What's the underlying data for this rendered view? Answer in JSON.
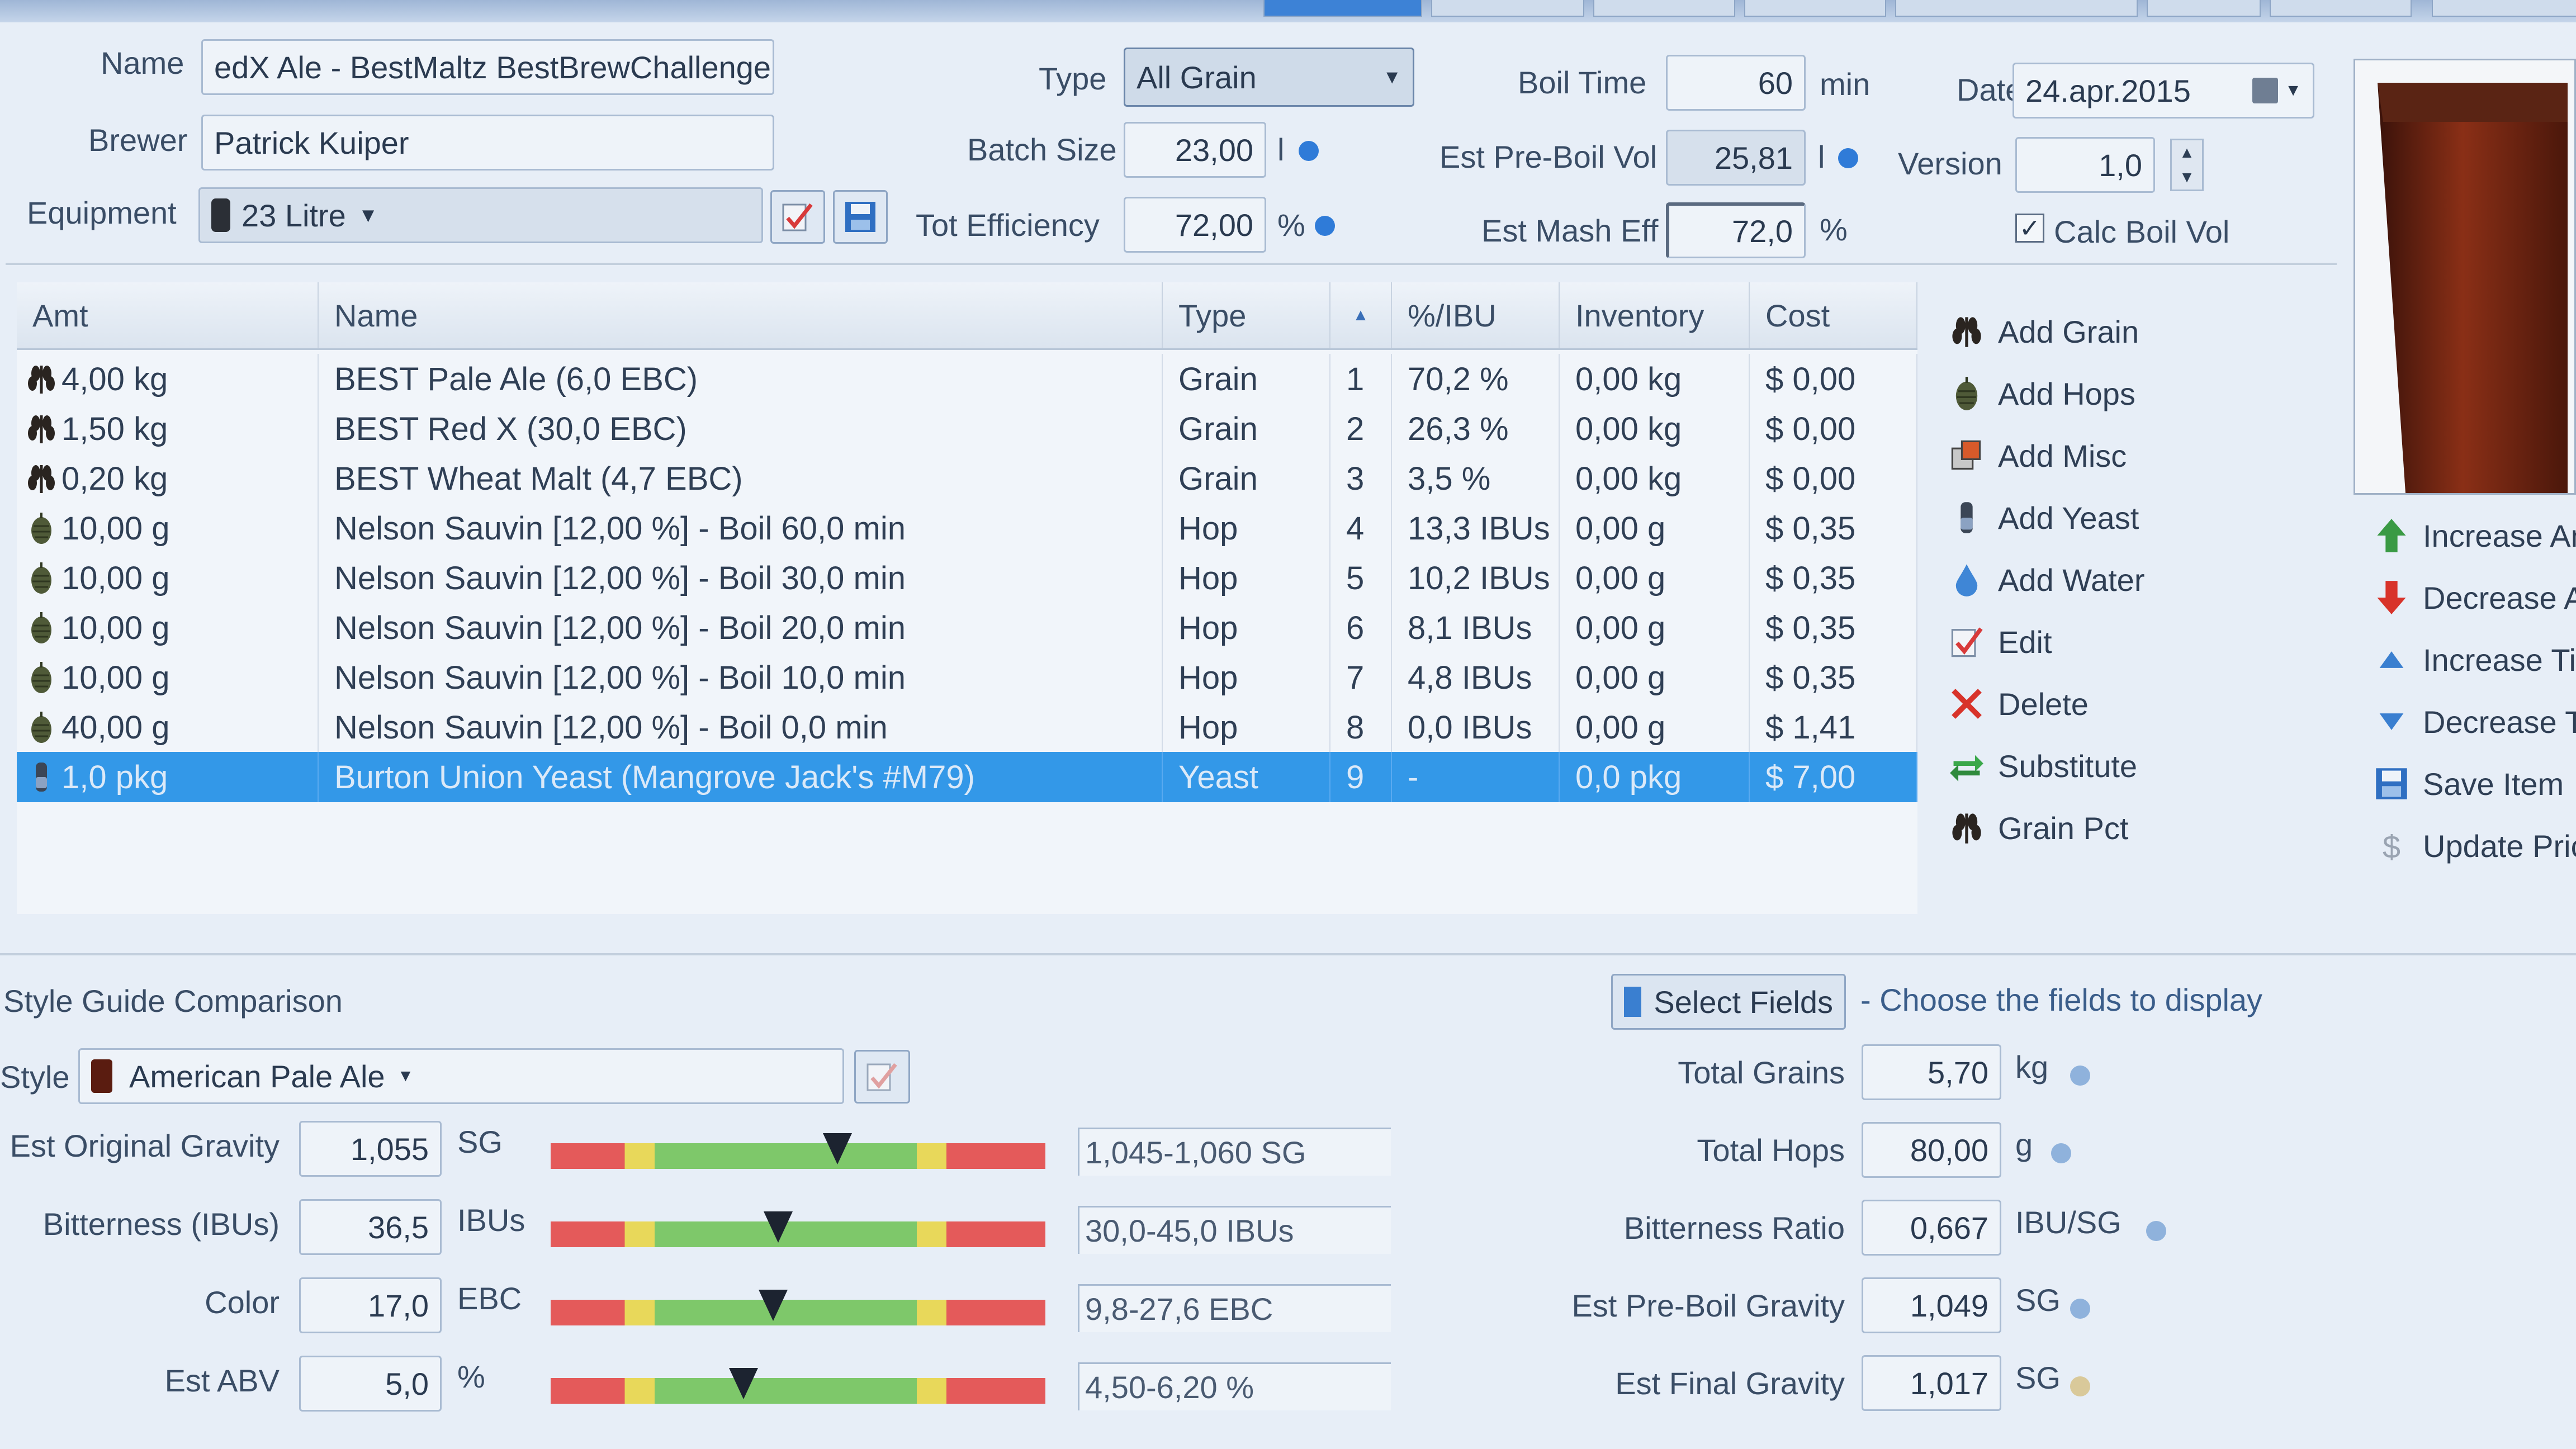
{
  "header": {
    "name_label": "Name",
    "name_value": "edX Ale - BestMaltz BestBrewChallenge",
    "brewer_label": "Brewer",
    "brewer_value": "Patrick Kuiper",
    "equipment_label": "Equipment",
    "equipment_value": "23 Litre",
    "type_label": "Type",
    "type_value": "All Grain",
    "batch_label": "Batch Size",
    "batch_value": "23,00",
    "batch_unit": "l",
    "eff_label": "Tot Efficiency",
    "eff_value": "72,00",
    "eff_unit": "%",
    "boil_label": "Boil Time",
    "boil_value": "60",
    "boil_unit": "min",
    "preboil_label": "Est Pre-Boil Vol",
    "preboil_value": "25,81",
    "preboil_unit": "l",
    "mash_label": "Est Mash Eff",
    "mash_value": "72,0",
    "mash_unit": "%",
    "date_label": "Date",
    "date_value": "24.apr.2015",
    "version_label": "Version",
    "version_value": "1,0",
    "calc_label": "Calc Boil Vol"
  },
  "grid": {
    "columns": [
      "Amt",
      "Name",
      "Type",
      "%/IBU",
      "Inventory",
      "Cost"
    ],
    "rows": [
      {
        "amt": "4,00 kg",
        "name": "BEST Pale Ale (6,0 EBC)",
        "type": "Grain",
        "num": "1",
        "ibu": "70,2 %",
        "inv": "0,00 kg",
        "cost": "$ 0,00",
        "icon": "grain-icon"
      },
      {
        "amt": "1,50 kg",
        "name": "BEST Red X (30,0 EBC)",
        "type": "Grain",
        "num": "2",
        "ibu": "26,3 %",
        "inv": "0,00 kg",
        "cost": "$ 0,00",
        "icon": "grain-icon"
      },
      {
        "amt": "0,20 kg",
        "name": "BEST Wheat Malt (4,7 EBC)",
        "type": "Grain",
        "num": "3",
        "ibu": "3,5 %",
        "inv": "0,00 kg",
        "cost": "$ 0,00",
        "icon": "grain-icon"
      },
      {
        "amt": "10,00 g",
        "name": "Nelson Sauvin [12,00 %] - Boil 60,0 min",
        "type": "Hop",
        "num": "4",
        "ibu": "13,3 IBUs",
        "inv": "0,00 g",
        "cost": "$ 0,35",
        "icon": "hop-icon"
      },
      {
        "amt": "10,00 g",
        "name": "Nelson Sauvin [12,00 %] - Boil 30,0 min",
        "type": "Hop",
        "num": "5",
        "ibu": "10,2 IBUs",
        "inv": "0,00 g",
        "cost": "$ 0,35",
        "icon": "hop-icon"
      },
      {
        "amt": "10,00 g",
        "name": "Nelson Sauvin [12,00 %] - Boil 20,0 min",
        "type": "Hop",
        "num": "6",
        "ibu": "8,1 IBUs",
        "inv": "0,00 g",
        "cost": "$ 0,35",
        "icon": "hop-icon"
      },
      {
        "amt": "10,00 g",
        "name": "Nelson Sauvin [12,00 %] - Boil 10,0 min",
        "type": "Hop",
        "num": "7",
        "ibu": "4,8 IBUs",
        "inv": "0,00 g",
        "cost": "$ 0,35",
        "icon": "hop-icon"
      },
      {
        "amt": "40,00 g",
        "name": "Nelson Sauvin [12,00 %] - Boil 0,0 min",
        "type": "Hop",
        "num": "8",
        "ibu": "0,0 IBUs",
        "inv": "0,00 g",
        "cost": "$ 1,41",
        "icon": "hop-icon"
      },
      {
        "amt": "1,0 pkg",
        "name": "Burton Union Yeast (Mangrove Jack's #M79)",
        "type": "Yeast",
        "num": "9",
        "ibu": "-",
        "inv": "0,0 pkg",
        "cost": "$ 7,00",
        "icon": "yeast-icon",
        "selected": true
      }
    ]
  },
  "actions": [
    {
      "label": "Add Grain",
      "icon": "grain-icon"
    },
    {
      "label": "Add Hops",
      "icon": "hop-icon"
    },
    {
      "label": "Add Misc",
      "icon": "misc-icon"
    },
    {
      "label": "Add Yeast",
      "icon": "yeast-icon"
    },
    {
      "label": "Add Water",
      "icon": "water-drop-icon"
    },
    {
      "label": "Edit",
      "icon": "edit-check-icon"
    },
    {
      "label": "Delete",
      "icon": "delete-x-icon"
    },
    {
      "label": "Substitute",
      "icon": "substitute-arrows-icon"
    },
    {
      "label": "Grain Pct",
      "icon": "grain-icon"
    }
  ],
  "side_actions": [
    {
      "label": "Increase Am",
      "icon": "up-arrow-icon"
    },
    {
      "label": "Decrease Ar",
      "icon": "down-arrow-icon"
    },
    {
      "label": "Increase Tin",
      "icon": "up-triangle-icon"
    },
    {
      "label": "Decrease Ti",
      "icon": "down-triangle-icon"
    },
    {
      "label": "Save Item",
      "icon": "save-icon"
    },
    {
      "label": "Update Pric",
      "icon": "dollar-icon"
    }
  ],
  "style": {
    "section_title": "Style Guide Comparison",
    "style_label": "Style",
    "style_value": "American Pale Ale",
    "select_fields": "Select Fields",
    "select_hint": "- Choose the fields to display",
    "gauges": [
      {
        "label": "Est Original Gravity",
        "value": "1,055",
        "unit": "SG",
        "range": "1,045-1,060 SG",
        "position": 0.58
      },
      {
        "label": "Bitterness (IBUs)",
        "value": "36,5",
        "unit": "IBUs",
        "range": "30,0-45,0 IBUs",
        "position": 0.46
      },
      {
        "label": "Color",
        "value": "17,0",
        "unit": "EBC",
        "range": "9,8-27,6 EBC",
        "position": 0.45
      },
      {
        "label": "Est ABV",
        "value": "5,0",
        "unit": "%",
        "range": "4,50-6,20 %",
        "position": 0.39
      }
    ],
    "stats": [
      {
        "label": "Total Grains",
        "value": "5,70",
        "unit": "kg",
        "dot": "blue"
      },
      {
        "label": "Total Hops",
        "value": "80,00",
        "unit": "g",
        "dot": "blue"
      },
      {
        "label": "Bitterness Ratio",
        "value": "0,667",
        "unit": "IBU/SG",
        "dot": "blue"
      },
      {
        "label": "Est Pre-Boil Gravity",
        "value": "1,049",
        "unit": "SG",
        "dot": "blue"
      },
      {
        "label": "Est Final Gravity",
        "value": "1,017",
        "unit": "SG",
        "dot": "yellow"
      }
    ]
  },
  "colors": {
    "selection": "#3398e8",
    "accent_blue": "#2f7bd8",
    "gauge_green": "#7ec86a",
    "gauge_yellow": "#e8d85a",
    "gauge_red": "#e45a5a",
    "beer": "#6a2412"
  }
}
